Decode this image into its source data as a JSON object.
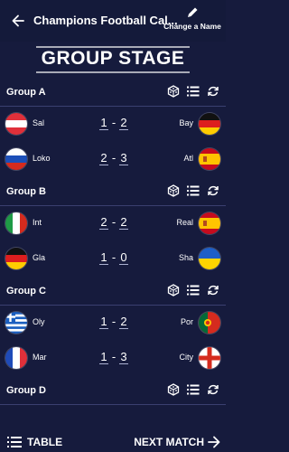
{
  "header": {
    "title": "Champions Football Cal...",
    "change_name_label": "Change a Name"
  },
  "banner": {
    "title": "GROUP STAGE"
  },
  "groups": [
    {
      "name": "Group A",
      "matches": [
        {
          "home": "Sal",
          "home_flag": "austria",
          "home_score": "1",
          "away_score": "2",
          "away": "Bay",
          "away_flag": "germany"
        },
        {
          "home": "Loko",
          "home_flag": "russia",
          "home_score": "2",
          "away_score": "3",
          "away": "Atl",
          "away_flag": "spain"
        }
      ]
    },
    {
      "name": "Group B",
      "matches": [
        {
          "home": "Int",
          "home_flag": "italy",
          "home_score": "2",
          "away_score": "2",
          "away": "Real",
          "away_flag": "spain"
        },
        {
          "home": "Gla",
          "home_flag": "germany",
          "home_score": "1",
          "away_score": "0",
          "away": "Sha",
          "away_flag": "ukraine"
        }
      ]
    },
    {
      "name": "Group C",
      "matches": [
        {
          "home": "Oly",
          "home_flag": "greece",
          "home_score": "1",
          "away_score": "2",
          "away": "Por",
          "away_flag": "portugal"
        },
        {
          "home": "Mar",
          "home_flag": "france",
          "home_score": "1",
          "away_score": "3",
          "away": "City",
          "away_flag": "england"
        }
      ]
    },
    {
      "name": "Group D",
      "matches": []
    }
  ],
  "footer": {
    "table_label": "TABLE",
    "next_label": "NEXT MATCH"
  },
  "colors": {
    "background": "#161b3d",
    "text": "#ffffff",
    "divider": "#3a4070"
  },
  "icons": [
    "back-arrow-icon",
    "pencil-icon",
    "dice-icon",
    "list-icon",
    "refresh-icon",
    "forward-arrow-icon"
  ]
}
